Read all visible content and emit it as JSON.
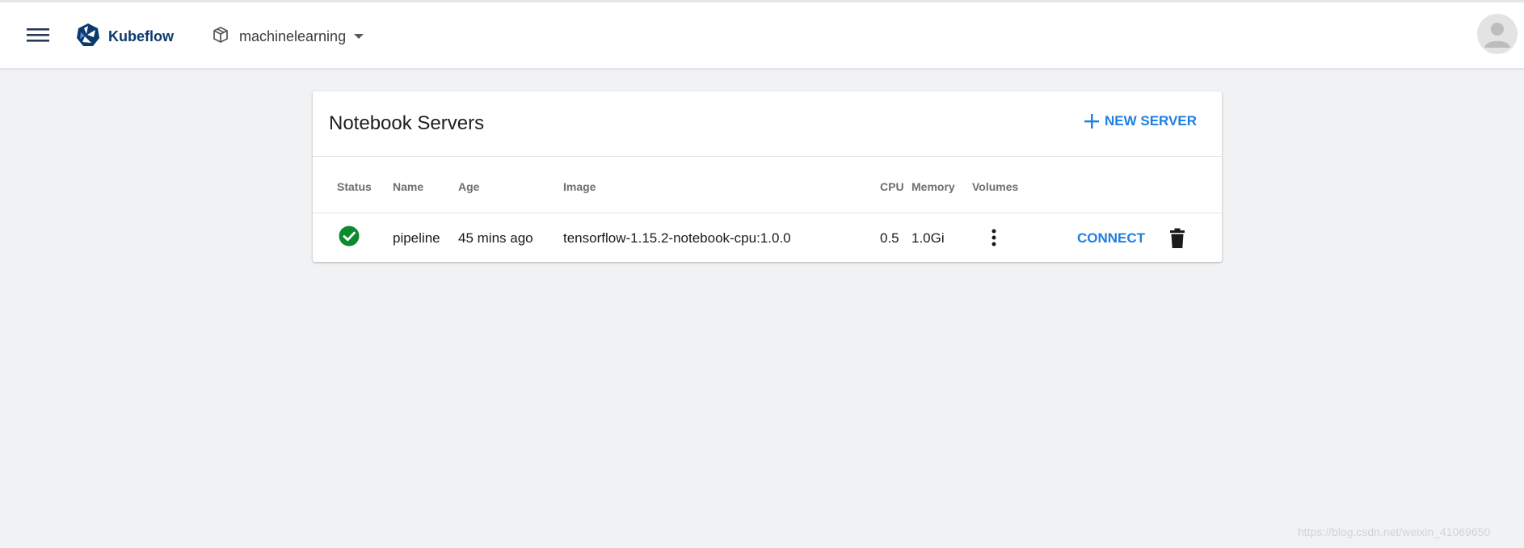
{
  "header": {
    "brand": "Kubeflow",
    "namespace": "machinelearning"
  },
  "card": {
    "title": "Notebook Servers",
    "new_server_label": "NEW SERVER"
  },
  "table": {
    "columns": {
      "status": "Status",
      "name": "Name",
      "age": "Age",
      "image": "Image",
      "cpu": "CPU",
      "memory": "Memory",
      "volumes": "Volumes"
    },
    "rows": [
      {
        "status": "ready",
        "name": "pipeline",
        "age": "45 mins ago",
        "image": "tensorflow-1.15.2-notebook-cpu:1.0.0",
        "cpu": "0.5",
        "memory": "1.0Gi",
        "connect_label": "CONNECT"
      }
    ]
  },
  "watermark": "https://blog.csdn.net/weixin_41069650",
  "icons": {
    "menu": "hamburger-menu-icon",
    "brand": "kubeflow-logo-icon",
    "namespace": "package-icon",
    "avatar": "account-circle-icon",
    "add": "plus-icon",
    "status": "check-circle-icon",
    "volumes": "more-vertical-icon",
    "delete": "trash-icon"
  },
  "colors": {
    "accent": "#1e7fe0",
    "brand_text": "#0d3a6e",
    "status_ok": "#0b8a2e",
    "background": "#f1f2f4"
  }
}
